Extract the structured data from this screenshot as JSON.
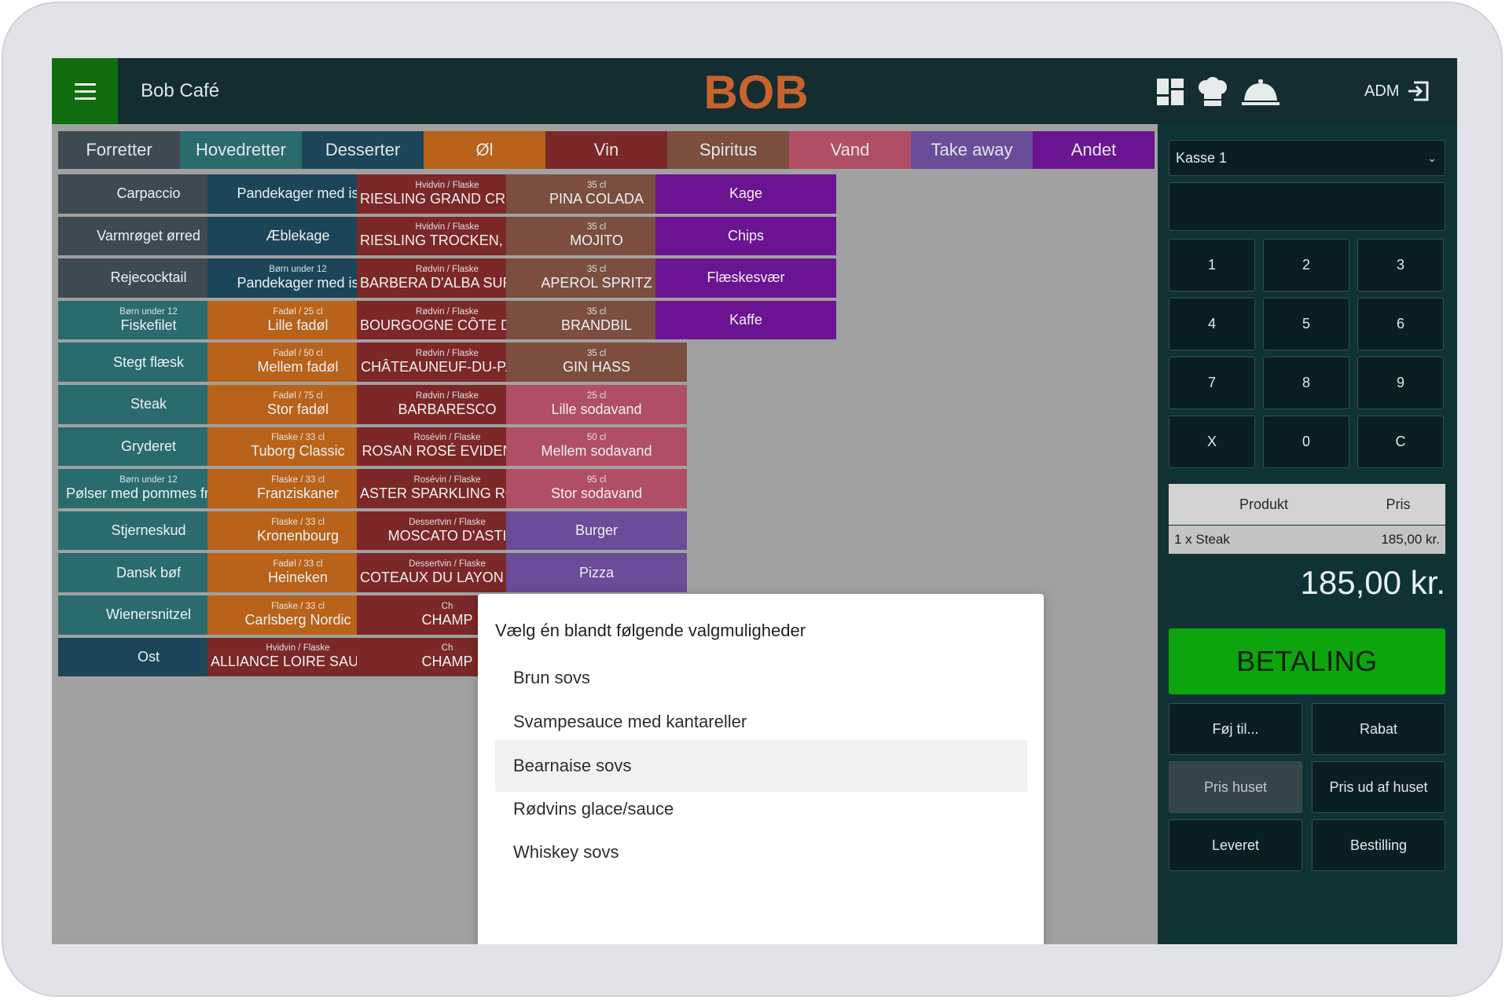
{
  "header": {
    "cafe_name": "Bob Café",
    "logo_text": "BOB",
    "adm_label": "ADM",
    "icons": [
      "menu-icon",
      "dashboard-icon",
      "chef-hat-icon",
      "cloche-icon",
      "logout-icon"
    ]
  },
  "colors": {
    "grey": "#3d4a52",
    "teal": "#2a6b6e",
    "navy": "#1b4558",
    "orange": "#b8621a",
    "wine": "#7c2828",
    "brown": "#7b4e40",
    "pink": "#b04e66",
    "lavender": "#6a4c98",
    "purple": "#6b1491",
    "pay_green": "#0da40d",
    "logo": "#c8632b"
  },
  "categories": [
    {
      "label": "Forretter",
      "color": "#3d4a52"
    },
    {
      "label": "Hovedretter",
      "color": "#2a6b6e"
    },
    {
      "label": "Desserter",
      "color": "#1b4558"
    },
    {
      "label": "Øl",
      "color": "#b8621a"
    },
    {
      "label": "Vin",
      "color": "#7c2828"
    },
    {
      "label": "Spiritus",
      "color": "#7b4e40"
    },
    {
      "label": "Vand",
      "color": "#b04e66"
    },
    {
      "label": "Take away",
      "color": "#6a4c98"
    },
    {
      "label": "Andet",
      "color": "#6b1491"
    }
  ],
  "columns": [
    [
      {
        "sub": "",
        "name": "Carpaccio",
        "color": "#3d4a52"
      },
      {
        "sub": "",
        "name": "Varmrøget ørred",
        "color": "#3d4a52"
      },
      {
        "sub": "",
        "name": "Rejecocktail",
        "color": "#3d4a52"
      },
      {
        "sub": "Børn under 12",
        "name": "Fiskefilet",
        "color": "#2a6b6e"
      },
      {
        "sub": "",
        "name": "Stegt flæsk",
        "color": "#2a6b6e"
      },
      {
        "sub": "",
        "name": "Steak",
        "color": "#2a6b6e"
      },
      {
        "sub": "",
        "name": "Gryderet",
        "color": "#2a6b6e"
      },
      {
        "sub": "Børn under 12",
        "name": "Pølser med pommes frites",
        "color": "#2a6b6e"
      },
      {
        "sub": "",
        "name": "Stjerneskud",
        "color": "#2a6b6e"
      },
      {
        "sub": "",
        "name": "Dansk bøf",
        "color": "#2a6b6e"
      },
      {
        "sub": "",
        "name": "Wienersnitzel",
        "color": "#2a6b6e"
      },
      {
        "sub": "",
        "name": "Ost",
        "color": "#1b4558"
      }
    ],
    [
      {
        "sub": "",
        "name": "Pandekager med is",
        "color": "#1b4558"
      },
      {
        "sub": "",
        "name": "Æblekage",
        "color": "#1b4558"
      },
      {
        "sub": "Børn under 12",
        "name": "Pandekager med is",
        "color": "#1b4558"
      },
      {
        "sub": "Fadøl / 25 cl",
        "name": "Lille fadøl",
        "color": "#b8621a"
      },
      {
        "sub": "Fadøl / 50 cl",
        "name": "Mellem fadøl",
        "color": "#b8621a"
      },
      {
        "sub": "Fadøl / 75 cl",
        "name": "Stor fadøl",
        "color": "#b8621a"
      },
      {
        "sub": "Flaske / 33 cl",
        "name": "Tuborg Classic",
        "color": "#b8621a"
      },
      {
        "sub": "Flaske / 33 cl",
        "name": "Franziskaner",
        "color": "#b8621a"
      },
      {
        "sub": "Flaske / 33 cl",
        "name": "Kronenbourg",
        "color": "#b8621a"
      },
      {
        "sub": "Fadøl / 33 cl",
        "name": "Heineken",
        "color": "#b8621a"
      },
      {
        "sub": "Flaske / 33 cl",
        "name": "Carlsberg Nordic",
        "color": "#b8621a"
      },
      {
        "sub": "Hvidvin / Flaske",
        "name": "ALLIANCE LOIRE SAUMUR BRUT",
        "color": "#7c2828"
      }
    ],
    [
      {
        "sub": "Hvidvin / Flaske",
        "name": "RIESLING GRAND CRU RANGEN",
        "color": "#7c2828"
      },
      {
        "sub": "Hvidvin / Flaske",
        "name": "RIESLING TROCKEN, NIERSTEIN",
        "color": "#7c2828"
      },
      {
        "sub": "Rødvin / Flaske",
        "name": "BARBERA D'ALBA SUPERIORE",
        "color": "#7c2828"
      },
      {
        "sub": "Rødvin / Flaske",
        "name": "BOURGOGNE CÔTE D'OR PINOT",
        "color": "#7c2828"
      },
      {
        "sub": "Rødvin / Flaske",
        "name": "CHÂTEAUNEUF-DU-PAPE",
        "color": "#7c2828"
      },
      {
        "sub": "Rødvin / Flaske",
        "name": "BARBARESCO",
        "color": "#7c2828"
      },
      {
        "sub": "Rosévin / Flaske",
        "name": "ROSAN ROSÉ EVIDENCE",
        "color": "#7c2828"
      },
      {
        "sub": "Rosévin / Flaske",
        "name": "ASTER SPARKLING ROSÉ",
        "color": "#7c2828"
      },
      {
        "sub": "Dessertvin / Flaske",
        "name": "MOSCATO D'ASTI",
        "color": "#7c2828"
      },
      {
        "sub": "Dessertvin / Flaske",
        "name": "COTEAUX DU LAYON ROCHEFORT",
        "color": "#7c2828"
      },
      {
        "sub": "Ch",
        "name": "CHAMP",
        "color": "#7c2828"
      },
      {
        "sub": "Ch",
        "name": "CHAMP",
        "color": "#7c2828"
      }
    ],
    [
      {
        "sub": "35 cl",
        "name": "PINA COLADA",
        "color": "#7b4e40"
      },
      {
        "sub": "35 cl",
        "name": "MOJITO",
        "color": "#7b4e40"
      },
      {
        "sub": "35 cl",
        "name": "APEROL SPRITZ",
        "color": "#7b4e40"
      },
      {
        "sub": "35 cl",
        "name": "BRANDBIL",
        "color": "#7b4e40"
      },
      {
        "sub": "35 cl",
        "name": "GIN HASS",
        "color": "#7b4e40"
      },
      {
        "sub": "25 cl",
        "name": "Lille sodavand",
        "color": "#b04e66"
      },
      {
        "sub": "50 cl",
        "name": "Mellem sodavand",
        "color": "#b04e66"
      },
      {
        "sub": "95 cl",
        "name": "Stor sodavand",
        "color": "#b04e66"
      },
      {
        "sub": "",
        "name": "Burger",
        "color": "#6a4c98"
      },
      {
        "sub": "",
        "name": "Pizza",
        "color": "#6a4c98"
      }
    ],
    [
      {
        "sub": "",
        "name": "Kage",
        "color": "#6b1491"
      },
      {
        "sub": "",
        "name": "Chips",
        "color": "#6b1491"
      },
      {
        "sub": "",
        "name": "Flæskesvær",
        "color": "#6b1491"
      },
      {
        "sub": "",
        "name": "Kaffe",
        "color": "#6b1491"
      }
    ]
  ],
  "panel": {
    "register": "Kasse 1",
    "keys": [
      "1",
      "2",
      "3",
      "4",
      "5",
      "6",
      "7",
      "8",
      "9",
      "X",
      "0",
      "C"
    ],
    "order_headers": {
      "product": "Produkt",
      "price": "Pris"
    },
    "order_rows": [
      {
        "item": "1 x Steak",
        "price": "185,00 kr."
      }
    ],
    "total": "185,00 kr.",
    "pay_label": "BETALING",
    "actions": [
      {
        "label": "Føj til...",
        "dim": false
      },
      {
        "label": "Rabat",
        "dim": false
      },
      {
        "label": "Pris huset",
        "dim": true
      },
      {
        "label": "Pris ud af huset",
        "dim": false
      },
      {
        "label": "Leveret",
        "dim": false
      },
      {
        "label": "Bestilling",
        "dim": false
      }
    ]
  },
  "modal": {
    "title": "Vælg én blandt følgende valgmuligheder",
    "options": [
      {
        "label": "Brun sovs",
        "highlight": false
      },
      {
        "label": "Svampesauce med kantareller",
        "highlight": false
      },
      {
        "label": "Bearnaise sovs",
        "highlight": true
      },
      {
        "label": "Rødvins glace/sauce",
        "highlight": false
      },
      {
        "label": "Whiskey sovs",
        "highlight": false
      }
    ]
  }
}
